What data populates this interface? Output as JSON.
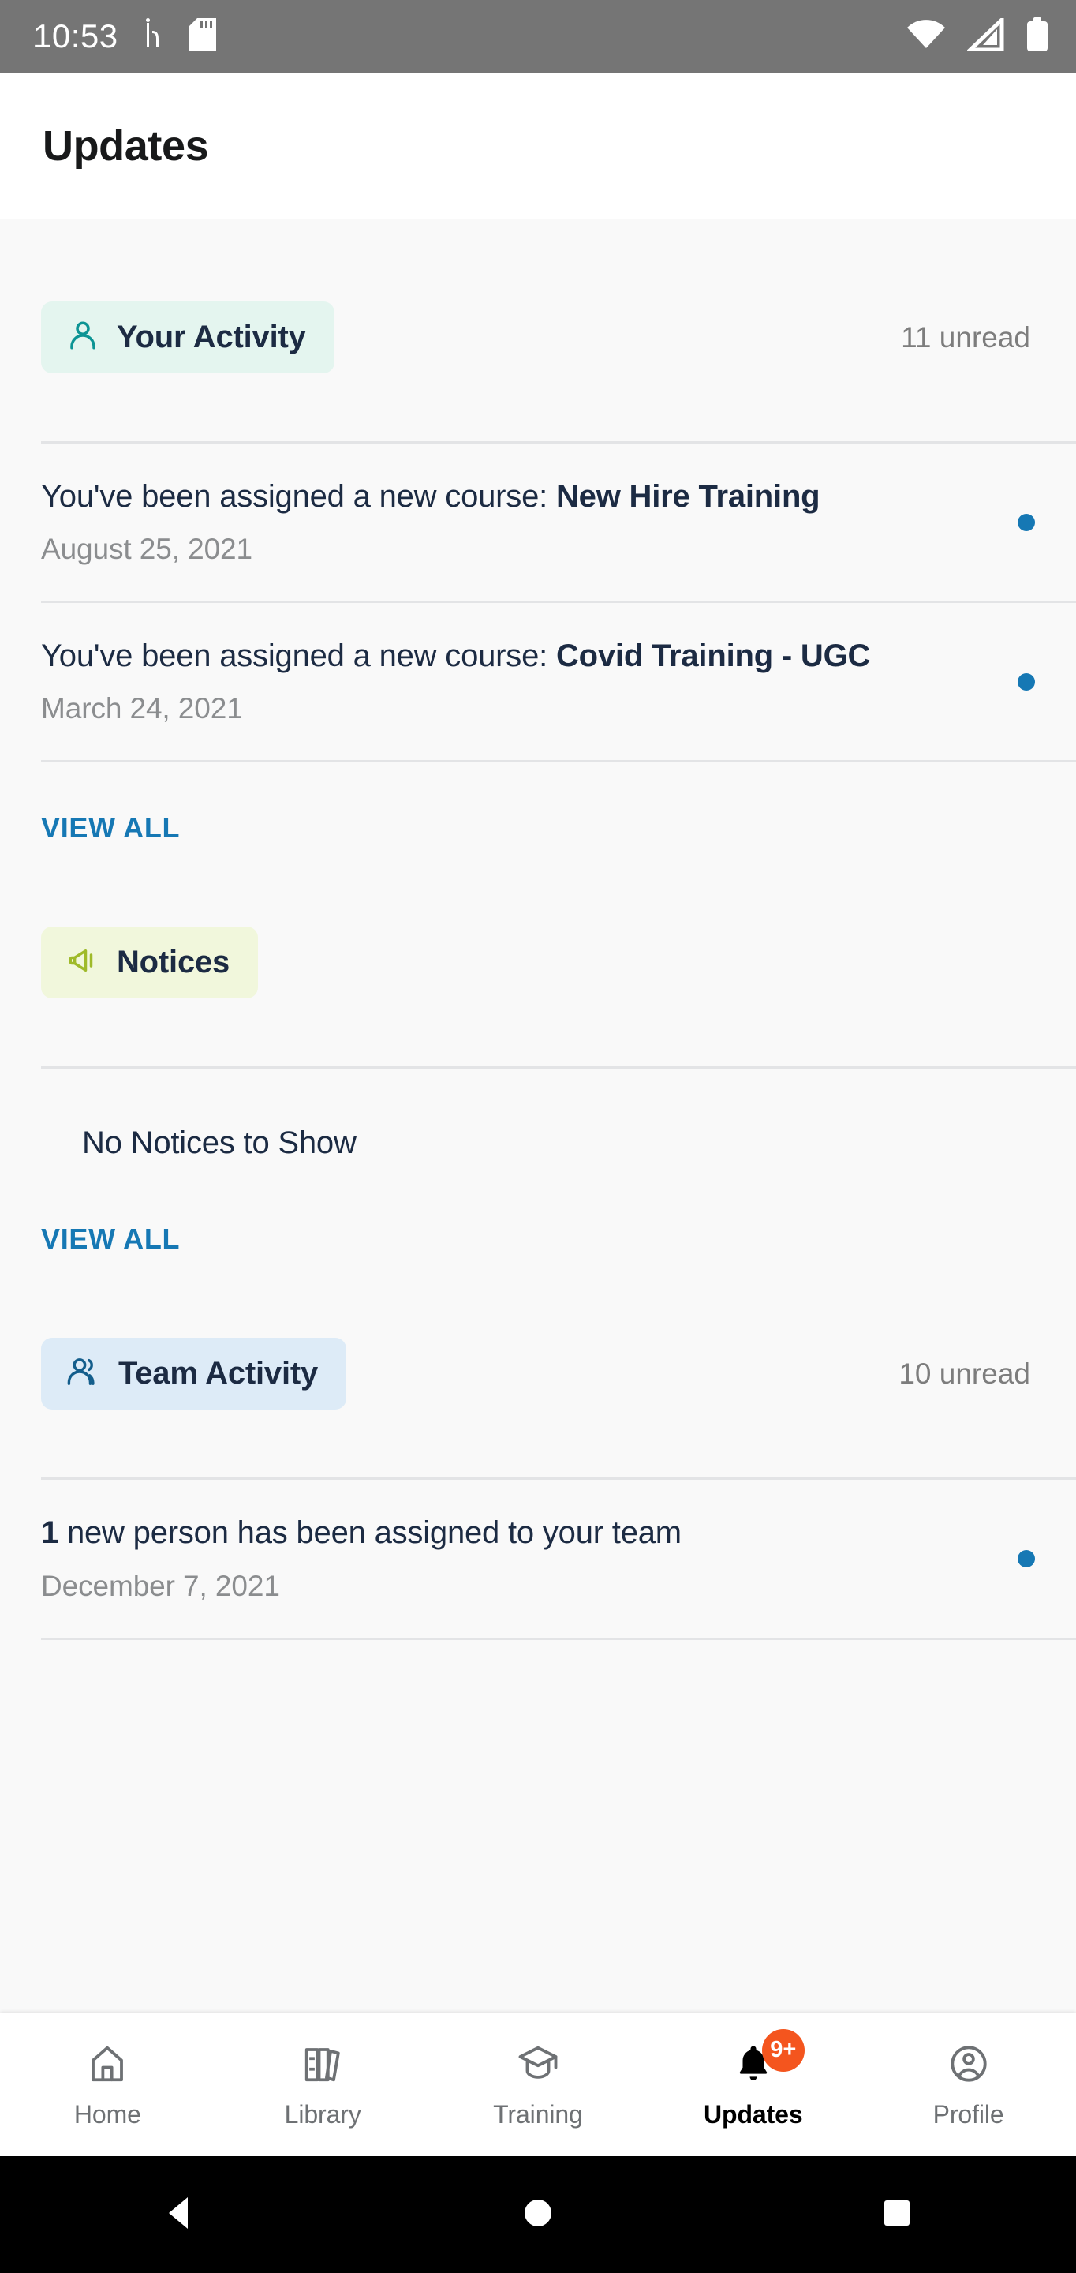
{
  "statusbar": {
    "time": "10:53",
    "icons": [
      "instagram-icon",
      "sd-card-icon",
      "wifi-icon",
      "cellular-signal-icon",
      "battery-icon"
    ]
  },
  "header": {
    "title": "Updates"
  },
  "sections": [
    {
      "key": "your-activity",
      "label": "Your Activity",
      "icon": "person-icon",
      "unread": "11 unread",
      "view_all": "VIEW ALL",
      "items": [
        {
          "prefix": "You've been assigned a new course: ",
          "highlight": "New Hire Training",
          "date": "August 25, 2021",
          "unread": true
        },
        {
          "prefix": "You've been assigned a new course: ",
          "highlight": "Covid Training - UGC",
          "date": "March 24, 2021",
          "unread": true
        }
      ]
    },
    {
      "key": "notices",
      "label": "Notices",
      "icon": "megaphone-icon",
      "unread": "",
      "empty_message": "No Notices to Show",
      "view_all": "VIEW ALL",
      "items": []
    },
    {
      "key": "team-activity",
      "label": "Team Activity",
      "icon": "people-icon",
      "unread": "10 unread",
      "items": [
        {
          "prefix": "1",
          "highlight": " new person has been assigned to your team",
          "date": "December 7, 2021",
          "unread": true
        }
      ]
    }
  ],
  "tabbar": {
    "items": [
      {
        "label": "Home",
        "icon": "home-icon",
        "active": false,
        "badge": ""
      },
      {
        "label": "Library",
        "icon": "books-icon",
        "active": false,
        "badge": ""
      },
      {
        "label": "Training",
        "icon": "graduation-cap-icon",
        "active": false,
        "badge": ""
      },
      {
        "label": "Updates",
        "icon": "bell-icon",
        "active": true,
        "badge": "9+"
      },
      {
        "label": "Profile",
        "icon": "account-circle-icon",
        "active": false,
        "badge": ""
      }
    ]
  },
  "androidnav": {
    "back": "back-triangle-icon",
    "home": "home-circle-icon",
    "recents": "recents-square-icon"
  },
  "colors": {
    "accent_blue": "#1678B4",
    "badge_orange": "#F4551E",
    "chip_teal_bg": "#E4F5EF",
    "chip_teal_icon": "#0D9494",
    "chip_lime_bg": "#F1F7DC",
    "chip_lime_icon": "#9FBA2A",
    "chip_blue_bg": "#DDEBF7",
    "chip_blue_icon": "#145E8C",
    "text_navy": "#1C2B43",
    "text_muted": "#8B8D8F"
  }
}
